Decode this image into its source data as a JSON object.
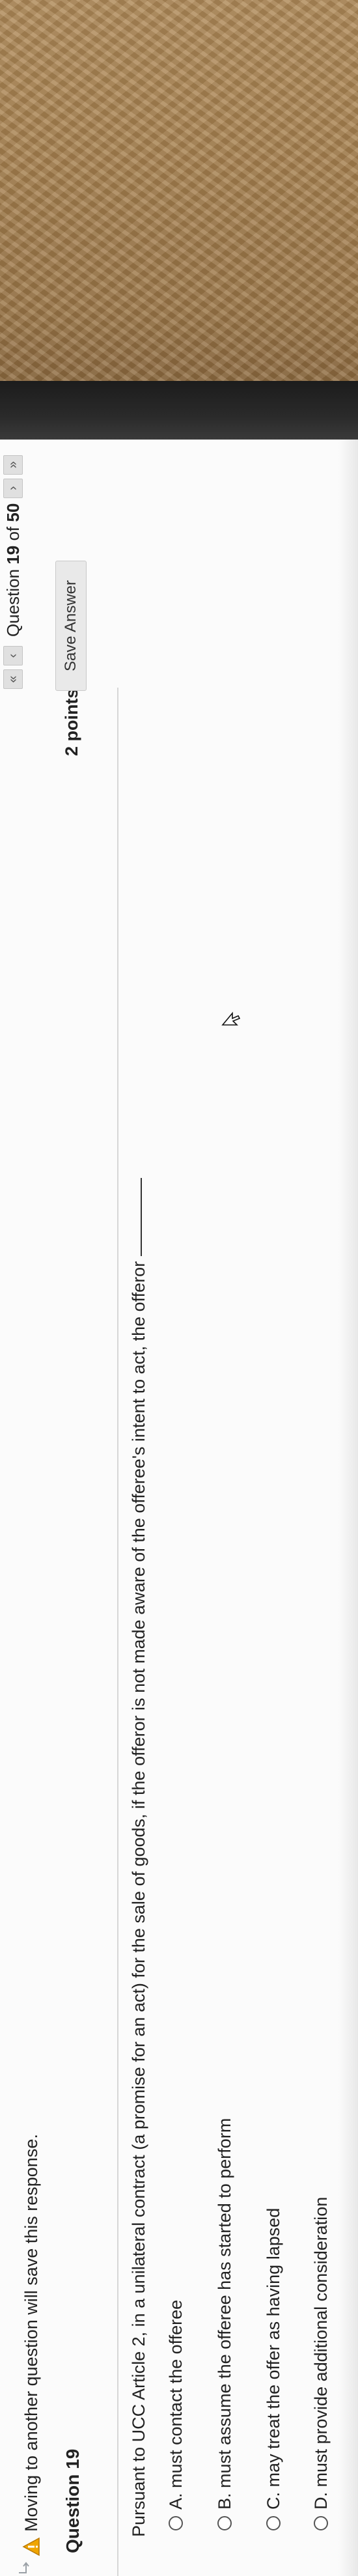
{
  "page": {
    "warning": "Moving to another question will save this response.",
    "question_heading": "Question 19",
    "points": "2 points",
    "save_button": "Save Answer"
  },
  "question_nav": {
    "label_prefix": "Question",
    "current": "19",
    "of_label": "of",
    "total": "50"
  },
  "question": {
    "prompt": "Pursuant to UCC Article 2, in a unilateral contract (a promise for an act) for the sale of goods, if the offeror is not made aware of the offeree's intent to act, the offeror",
    "options": [
      {
        "label": "A. must contact the offeree"
      },
      {
        "label": "B. must assume the offeree has started to perform"
      },
      {
        "label": "C. may treat the offer as having lapsed"
      },
      {
        "label": "D. must provide additional consideration"
      }
    ]
  },
  "colors": {
    "warning_icon": "#f0a500",
    "text": "#222222",
    "button_bg": "#e9e9e9"
  },
  "icons": {
    "back": "return-arrow-icon",
    "warning": "warning-triangle-icon",
    "first": "double-chevron-left-icon",
    "prev": "chevron-left-icon",
    "next": "chevron-right-icon",
    "last": "double-chevron-right-icon"
  }
}
